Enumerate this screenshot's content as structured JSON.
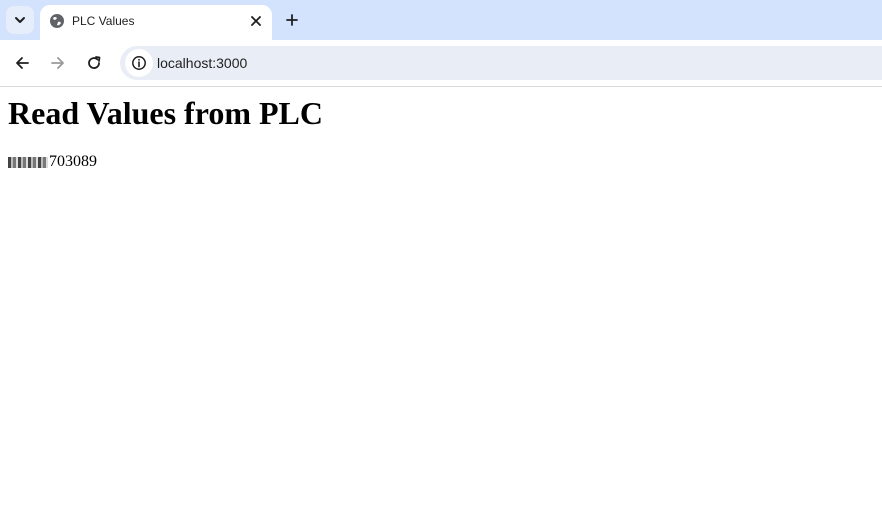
{
  "browser": {
    "tab": {
      "title": "PLC Values"
    },
    "address_bar": {
      "url": "localhost:3000"
    },
    "icons": {
      "tab_search": "chevron-down-icon",
      "favicon": "globe-icon",
      "close": "close-icon",
      "new_tab": "plus-icon",
      "back": "back-arrow-icon",
      "forward": "forward-arrow-icon",
      "reload": "reload-icon",
      "site_info": "info-icon"
    },
    "colors": {
      "tabstrip": "#d3e3fd",
      "omnibox": "#e9eef6"
    }
  },
  "page": {
    "heading": "Read Values from PLC",
    "value_visible": "703089"
  }
}
